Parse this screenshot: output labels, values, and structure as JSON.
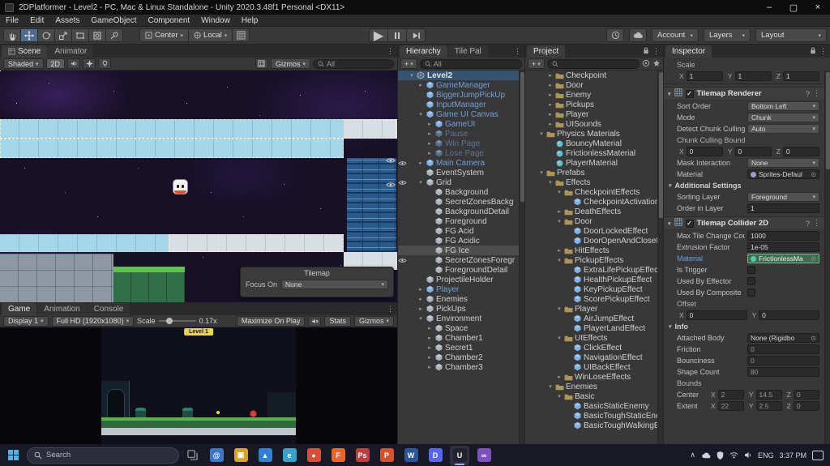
{
  "title_bar": {
    "title": "2DPlatformer - Level2 - PC, Mac & Linux Standalone - Unity 2020.3.48f1 Personal <DX11>"
  },
  "menu_bar": [
    "File",
    "Edit",
    "Assets",
    "GameObject",
    "Component",
    "Window",
    "Help"
  ],
  "toolbar": {
    "pivot": "Center",
    "rotation": "Local",
    "account": "Account",
    "layers": "Layers",
    "layout": "Layout"
  },
  "scene_panel": {
    "tabs": [
      "Scene",
      "Animator"
    ],
    "toolbar": {
      "shading": "Shaded",
      "mode2d": "2D",
      "gizmos": "Gizmos",
      "search": "All"
    },
    "overlay": {
      "title": "Tilemap",
      "focus_label": "Focus On",
      "focus_value": "None"
    }
  },
  "game_panel": {
    "tabs": [
      "Game",
      "Animation",
      "Console"
    ],
    "toolbar": {
      "display": "Display 1",
      "resolution": "Full HD (1920x1080)",
      "scale_label": "Scale",
      "scale_value": "0.17x",
      "maximize": "Maximize On Play",
      "stats": "Stats",
      "gizmos": "Gizmos"
    },
    "hud_level": "Level 1"
  },
  "hierarchy_panel": {
    "tabs": [
      "Hierarchy",
      "Tile Pal"
    ],
    "create_button": "+",
    "search": "All",
    "items": [
      {
        "label": "Level2",
        "d": 0,
        "t": "scene",
        "a": "v",
        "sel": "blue"
      },
      {
        "label": "GameManager",
        "d": 1,
        "t": "prefab",
        "a": ">"
      },
      {
        "label": "BiggerJumpPickUp",
        "d": 1,
        "t": "prefab",
        "a": ""
      },
      {
        "label": "InputManager",
        "d": 1,
        "t": "prefab",
        "a": ""
      },
      {
        "label": "Game UI Canvas",
        "d": 1,
        "t": "prefab",
        "a": "v"
      },
      {
        "label": "GameUI",
        "d": 2,
        "t": "prefab",
        "a": ">"
      },
      {
        "label": "Pause",
        "d": 2,
        "t": "prefab-off",
        "a": ">"
      },
      {
        "label": "Win Page",
        "d": 2,
        "t": "prefab-off",
        "a": ">"
      },
      {
        "label": "Lose Page",
        "d": 2,
        "t": "prefab-off",
        "a": ">"
      },
      {
        "label": "Main Camera",
        "d": 1,
        "t": "prefab",
        "a": ">",
        "eye": true
      },
      {
        "label": "EventSystem",
        "d": 1,
        "t": "go",
        "a": ""
      },
      {
        "label": "Grid",
        "d": 1,
        "t": "go",
        "a": "v",
        "eye": true
      },
      {
        "label": "Background",
        "d": 2,
        "t": "go",
        "a": ""
      },
      {
        "label": "SecretZonesBackg",
        "d": 2,
        "t": "go",
        "a": ""
      },
      {
        "label": "BackgroundDetail",
        "d": 2,
        "t": "go",
        "a": ""
      },
      {
        "label": "Foreground",
        "d": 2,
        "t": "go",
        "a": ""
      },
      {
        "label": "FG Acid",
        "d": 2,
        "t": "go",
        "a": ""
      },
      {
        "label": "FG Acidic",
        "d": 2,
        "t": "go",
        "a": ""
      },
      {
        "label": "FG Ice",
        "d": 2,
        "t": "go",
        "a": "",
        "sel": "gray"
      },
      {
        "label": "SecretZonesForegr",
        "d": 2,
        "t": "go",
        "a": "",
        "eye": true
      },
      {
        "label": "ForegroundDetail",
        "d": 2,
        "t": "go",
        "a": ""
      },
      {
        "label": "ProjectileHolder",
        "d": 1,
        "t": "go",
        "a": ""
      },
      {
        "label": "Player",
        "d": 1,
        "t": "prefab",
        "a": ">"
      },
      {
        "label": "Enemies",
        "d": 1,
        "t": "go",
        "a": ">"
      },
      {
        "label": "PickUps",
        "d": 1,
        "t": "go",
        "a": ">"
      },
      {
        "label": "Environment",
        "d": 1,
        "t": "go",
        "a": "v"
      },
      {
        "label": "Space",
        "d": 2,
        "t": "go",
        "a": ">"
      },
      {
        "label": "Chamber1",
        "d": 2,
        "t": "go",
        "a": ">"
      },
      {
        "label": "Secret1",
        "d": 2,
        "t": "go",
        "a": ">"
      },
      {
        "label": "Chamber2",
        "d": 2,
        "t": "go",
        "a": ">"
      },
      {
        "label": "Chamber3",
        "d": 2,
        "t": "go",
        "a": ">"
      }
    ]
  },
  "project_panel": {
    "tab": "Project",
    "create_button": "+",
    "items": [
      {
        "label": "Checkpoint",
        "d": 2,
        "t": "folder",
        "a": ">"
      },
      {
        "label": "Door",
        "d": 2,
        "t": "folder",
        "a": ">"
      },
      {
        "label": "Enemy",
        "d": 2,
        "t": "folder",
        "a": ">"
      },
      {
        "label": "Pickups",
        "d": 2,
        "t": "folder",
        "a": ">"
      },
      {
        "label": "Player",
        "d": 2,
        "t": "folder",
        "a": ">"
      },
      {
        "label": "UISounds",
        "d": 2,
        "t": "folder",
        "a": ">"
      },
      {
        "label": "Physics Materials",
        "d": 1,
        "t": "folder",
        "a": "v"
      },
      {
        "label": "BouncyMaterial",
        "d": 2,
        "t": "mat",
        "a": ""
      },
      {
        "label": "FrictionlessMaterial",
        "d": 2,
        "t": "mat",
        "a": ""
      },
      {
        "label": "PlayerMaterial",
        "d": 2,
        "t": "mat",
        "a": ""
      },
      {
        "label": "Prefabs",
        "d": 1,
        "t": "folder",
        "a": "v"
      },
      {
        "label": "Effects",
        "d": 2,
        "t": "folder",
        "a": "v"
      },
      {
        "label": "CheckpointEffects",
        "d": 3,
        "t": "folder",
        "a": "v"
      },
      {
        "label": "CheckpointActivation",
        "d": 4,
        "t": "prefab",
        "a": ""
      },
      {
        "label": "DeathEffects",
        "d": 3,
        "t": "folder",
        "a": ">"
      },
      {
        "label": "Door",
        "d": 3,
        "t": "folder",
        "a": "v"
      },
      {
        "label": "DoorLockedEffect",
        "d": 4,
        "t": "prefab",
        "a": ""
      },
      {
        "label": "DoorOpenAndCloseEff",
        "d": 4,
        "t": "prefab",
        "a": ""
      },
      {
        "label": "HitEffects",
        "d": 3,
        "t": "folder",
        "a": ">"
      },
      {
        "label": "PickupEffects",
        "d": 3,
        "t": "folder",
        "a": "v"
      },
      {
        "label": "ExtraLifePickupEffect",
        "d": 4,
        "t": "prefab",
        "a": ""
      },
      {
        "label": "HealthPickupEffect",
        "d": 4,
        "t": "prefab",
        "a": ""
      },
      {
        "label": "KeyPickupEffect",
        "d": 4,
        "t": "prefab",
        "a": ""
      },
      {
        "label": "ScorePickupEffect",
        "d": 4,
        "t": "prefab",
        "a": ""
      },
      {
        "label": "Player",
        "d": 3,
        "t": "folder",
        "a": "v"
      },
      {
        "label": "AirJumpEffect",
        "d": 4,
        "t": "prefab",
        "a": ""
      },
      {
        "label": "PlayerLandEffect",
        "d": 4,
        "t": "prefab",
        "a": ""
      },
      {
        "label": "UIEffects",
        "d": 3,
        "t": "folder",
        "a": "v"
      },
      {
        "label": "ClickEffect",
        "d": 4,
        "t": "prefab",
        "a": ""
      },
      {
        "label": "NavigationEffect",
        "d": 4,
        "t": "prefab",
        "a": ""
      },
      {
        "label": "UIBackEffect",
        "d": 4,
        "t": "prefab",
        "a": ""
      },
      {
        "label": "WinLoseEffects",
        "d": 3,
        "t": "folder",
        "a": ">"
      },
      {
        "label": "Enemies",
        "d": 2,
        "t": "folder",
        "a": "v"
      },
      {
        "label": "Basic",
        "d": 3,
        "t": "folder",
        "a": "v"
      },
      {
        "label": "BasicStaticEnemy",
        "d": 4,
        "t": "prefab",
        "a": ""
      },
      {
        "label": "BasicToughStaticEner",
        "d": 4,
        "t": "prefab",
        "a": ""
      },
      {
        "label": "BasicToughWalkingEn",
        "d": 4,
        "t": "prefab",
        "a": ""
      }
    ]
  },
  "inspector_panel": {
    "tab": "Inspector",
    "transform": {
      "label": "Scale",
      "axes": [
        {
          "a": "X",
          "v": "1"
        },
        {
          "a": "Y",
          "v": "1"
        },
        {
          "a": "Z",
          "v": "1"
        }
      ]
    },
    "components": [
      {
        "name": "Tilemap Renderer",
        "enabled": true,
        "rows": [
          {
            "type": "dropdown",
            "label": "Sort Order",
            "value": "Bottom Left"
          },
          {
            "type": "dropdown",
            "label": "Mode",
            "value": "Chunk"
          },
          {
            "type": "dropdown",
            "label": "Detect Chunk Culling",
            "value": "Auto"
          },
          {
            "type": "sublabel",
            "label": "Chunk Culling Bounds"
          },
          {
            "type": "vector",
            "fields": [
              {
                "axis": "X",
                "value": "0"
              },
              {
                "axis": "Y",
                "value": "0"
              },
              {
                "axis": "Z",
                "value": "0"
              }
            ]
          },
          {
            "type": "dropdown",
            "label": "Mask Interaction",
            "value": "None"
          },
          {
            "type": "object",
            "label": "Material",
            "value": "Sprites-Defaul",
            "icon": "#a89ac8"
          },
          {
            "type": "foldout",
            "label": "Additional Settings"
          },
          {
            "type": "dropdown",
            "label": "Sorting Layer",
            "value": "Foreground"
          },
          {
            "type": "field",
            "label": "Order in Layer",
            "value": "1"
          }
        ]
      },
      {
        "name": "Tilemap Collider 2D",
        "enabled": true,
        "rows": [
          {
            "type": "field",
            "label": "Max Tile Change Cou",
            "value": "1000"
          },
          {
            "type": "field",
            "label": "Extrusion Factor",
            "value": "1e-05"
          },
          {
            "type": "object",
            "label": "Material",
            "value": "FrictionlessMa",
            "icon": "#58c8a8",
            "highlight": true
          },
          {
            "type": "checkbox",
            "label": "Is Trigger",
            "checked": false
          },
          {
            "type": "checkbox",
            "label": "Used By Effector",
            "checked": false
          },
          {
            "type": "checkbox",
            "label": "Used By Composite",
            "checked": false
          },
          {
            "type": "sublabel",
            "label": "Offset"
          },
          {
            "type": "vector",
            "fields": [
              {
                "axis": "X",
                "value": "0"
              },
              {
                "axis": "Y",
                "value": "0"
              }
            ]
          },
          {
            "type": "foldout",
            "label": "Info"
          },
          {
            "type": "object",
            "label": "Attached Body",
            "value": "None (Rigidbo",
            "ro": true
          },
          {
            "type": "field",
            "label": "Friction",
            "value": "0",
            "ro": true
          },
          {
            "type": "field",
            "label": "Bounciness",
            "value": "0",
            "ro": true
          },
          {
            "type": "field",
            "label": "Shape Count",
            "value": "80",
            "ro": true
          },
          {
            "type": "sublabel",
            "label": "Bounds"
          },
          {
            "type": "vector",
            "label": "Center",
            "ro": true,
            "fields": [
              {
                "axis": "X",
                "value": "2"
              },
              {
                "axis": "Y",
                "value": "14.5"
              },
              {
                "axis": "Z",
                "value": "0"
              }
            ]
          },
          {
            "type": "vector",
            "label": "Extent",
            "ro": true,
            "fields": [
              {
                "axis": "X",
                "value": "22"
              },
              {
                "axis": "Y",
                "value": "2.5"
              },
              {
                "axis": "Z",
                "value": "0"
              }
            ]
          }
        ]
      }
    ]
  },
  "taskbar": {
    "search": "Search",
    "lang": "ENG",
    "time": "3:37 PM",
    "apps": [
      {
        "name": "mail",
        "glyph": "@",
        "color": "#3b76c9"
      },
      {
        "name": "file-explorer",
        "glyph": "▣",
        "color": "#d8a425"
      },
      {
        "name": "photos",
        "glyph": "▲",
        "color": "#2f7fd4"
      },
      {
        "name": "edge",
        "glyph": "e",
        "color": "#35a3c9"
      },
      {
        "name": "chrome",
        "glyph": "●",
        "color": "#dd4b39"
      },
      {
        "name": "firefox",
        "glyph": "F",
        "color": "#e8652b"
      },
      {
        "name": "photoshop",
        "glyph": "Ps",
        "color": "#c43b3b"
      },
      {
        "name": "powerpoint",
        "glyph": "P",
        "color": "#d35230"
      },
      {
        "name": "word",
        "glyph": "W",
        "color": "#2b579a"
      },
      {
        "name": "discord",
        "glyph": "D",
        "color": "#5865f2"
      },
      {
        "name": "unity-editor",
        "glyph": "U",
        "color": "#23232e",
        "active": true
      },
      {
        "name": "visual-studio",
        "glyph": "∞",
        "color": "#7b51bd"
      }
    ]
  }
}
